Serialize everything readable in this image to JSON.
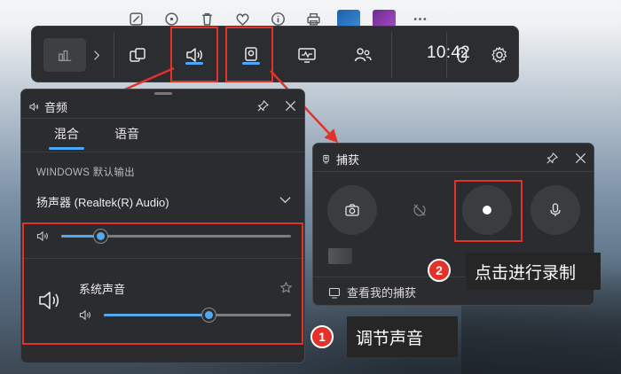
{
  "game_bar": {
    "clock": "10:42",
    "widgets": [
      "home-widget",
      "performance-widget",
      "audio-widget",
      "capture-widget",
      "resources-widget",
      "social-widget"
    ]
  },
  "audio_panel": {
    "title": "音频",
    "tabs": [
      {
        "label": "混合",
        "active": true
      },
      {
        "label": "语音",
        "active": false
      }
    ],
    "output_section_label": "WINDOWS 默认输出",
    "output_device": "扬声器 (Realtek(R) Audio)",
    "master_volume": 0.17,
    "apps": [
      {
        "name": "系统声音",
        "volume": 0.56
      }
    ]
  },
  "capture_panel": {
    "title": "捕获",
    "buttons": [
      "screenshot-icon",
      "record-last-icon",
      "record-icon",
      "microphone-icon"
    ],
    "view_captures_link": "查看我的捕获"
  },
  "annotations": [
    {
      "number": "1",
      "text": "调节声音"
    },
    {
      "number": "2",
      "text": "点击进行录制"
    }
  ],
  "colors": {
    "accent": "#4aa8ff",
    "highlight": "#e2322a",
    "panel": "#2b2c2f"
  }
}
